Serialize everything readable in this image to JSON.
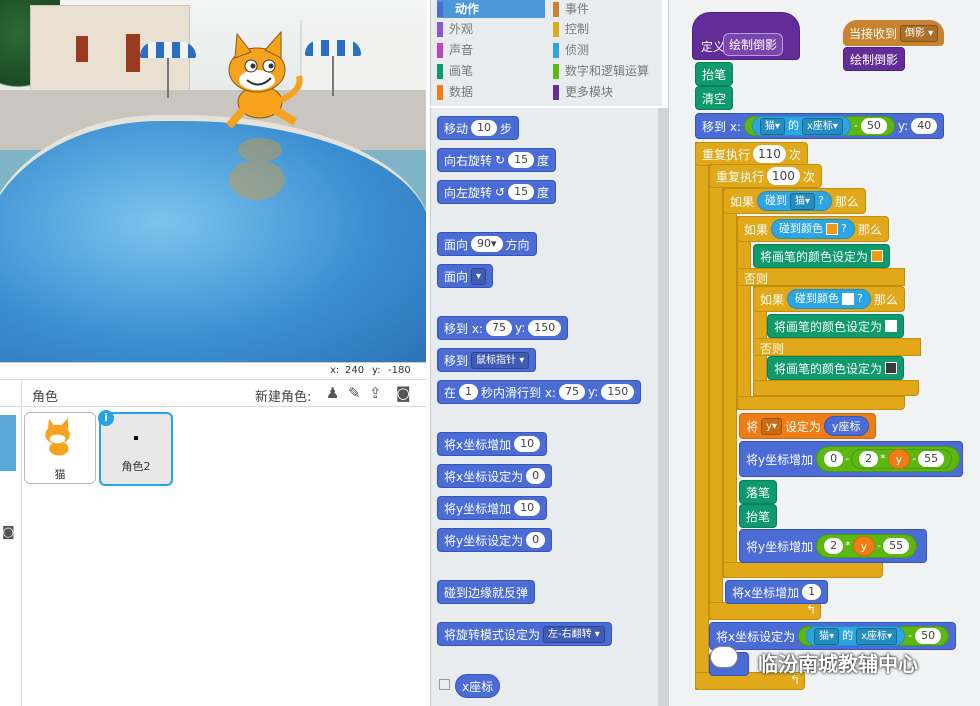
{
  "stage": {
    "coords": {
      "x_label": "x:",
      "x_value": "240",
      "y_label": "y:",
      "y_value": "-180"
    }
  },
  "sprites": {
    "header": "角色",
    "new_sprite_label": "新建角色:",
    "items": [
      {
        "name": "猫",
        "selected": false
      },
      {
        "name": "角色2",
        "selected": true
      }
    ],
    "info_badge": "i"
  },
  "categories": [
    {
      "label": "动作",
      "color": "#4a6cd4",
      "active": true
    },
    {
      "label": "事件",
      "color": "#c88330",
      "active": false
    },
    {
      "label": "外观",
      "color": "#8a55d7",
      "active": false
    },
    {
      "label": "控制",
      "color": "#e1a91a",
      "active": false
    },
    {
      "label": "声音",
      "color": "#bb42c3",
      "active": false
    },
    {
      "label": "侦测",
      "color": "#2ca5e2",
      "active": false
    },
    {
      "label": "画笔",
      "color": "#0e9a6c",
      "active": false
    },
    {
      "label": "数字和逻辑运算",
      "color": "#5cb712",
      "active": false
    },
    {
      "label": "数据",
      "color": "#ee7d16",
      "active": false
    },
    {
      "label": "更多模块",
      "color": "#632d99",
      "active": false
    }
  ],
  "palette": {
    "move": {
      "label": "移动",
      "steps": "10",
      "unit": "步"
    },
    "turn_right": {
      "label": "向右旋转",
      "deg": "15",
      "unit": "度"
    },
    "turn_left": {
      "label": "向左旋转",
      "deg": "15",
      "unit": "度"
    },
    "point_dir": {
      "label": "面向",
      "dir": "90▾",
      "unit": "方向"
    },
    "point_towards": {
      "label": "面向"
    },
    "goto_xy": {
      "label": "移到 x:",
      "x": "75",
      "ylabel": "y:",
      "y": "150"
    },
    "goto": {
      "label": "移到",
      "target": "鼠标指针"
    },
    "glide": {
      "label": "在",
      "secs": "1",
      "mid": "秒内滑行到 x:",
      "x": "75",
      "ylabel": "y:",
      "y": "150"
    },
    "change_x": {
      "label": "将x坐标增加",
      "val": "10"
    },
    "set_x": {
      "label": "将x坐标设定为",
      "val": "0"
    },
    "change_y": {
      "label": "将y坐标增加",
      "val": "10"
    },
    "set_y": {
      "label": "将y坐标设定为",
      "val": "0"
    },
    "bounce": {
      "label": "碰到边缘就反弹"
    },
    "rotation_style": {
      "label": "将旋转模式设定为",
      "val": "左-右翻转"
    },
    "xpos": {
      "label": "x座标"
    }
  },
  "script": {
    "define": {
      "label": "定义",
      "name": "绘制倒影"
    },
    "broadcast_hat": {
      "label": "当接收到",
      "msg": "倒影"
    },
    "call": {
      "label": "绘制倒影"
    },
    "pen_up": "抬笔",
    "clear": "清空",
    "move_to": {
      "label": "移到 x:",
      "obj": "猫",
      "of": "的",
      "prop": "x座标",
      "minus": "-",
      "num": "50",
      "ylabel": "y:",
      "y": "40"
    },
    "repeat1": {
      "label": "重复执行",
      "n": "110",
      "unit": "次"
    },
    "repeat2": {
      "label": "重复执行",
      "n": "100",
      "unit": "次"
    },
    "if1": {
      "label": "如果",
      "cond": "碰到",
      "obj": "猫",
      "q": "?",
      "then": "那么"
    },
    "if2": {
      "label": "如果",
      "cond": "碰到颜色",
      "q": "?",
      "then": "那么",
      "color": "#f29a12"
    },
    "setpen1": {
      "label": "将画笔的颜色设定为",
      "color": "#f29a12"
    },
    "else1": "否则",
    "if3": {
      "label": "如果",
      "cond": "碰到颜色",
      "q": "?",
      "then": "那么",
      "color": "#ffffff"
    },
    "setpen2": {
      "label": "将画笔的颜色设定为",
      "color": "#ffffff"
    },
    "else2": "否则",
    "setpen3": {
      "label": "将画笔的颜色设定为",
      "color": "#3a3a3a"
    },
    "set_var": {
      "label": "将",
      "var": "y",
      "mid": "设定为",
      "val": "y座标"
    },
    "change_y1": {
      "label": "将y坐标增加",
      "a": "0",
      "minus": "-",
      "b": "2",
      "times": "*",
      "v": "y",
      "minus2": "-",
      "c": "55"
    },
    "pen_down": "落笔",
    "pen_up2": "抬笔",
    "change_y2": {
      "label": "将y坐标增加",
      "b": "2",
      "times": "*",
      "v": "y",
      "minus": "-",
      "c": "55"
    },
    "change_x": {
      "label": "将x坐标增加",
      "val": "1"
    },
    "set_x": {
      "label": "将x坐标设定为",
      "obj": "猫",
      "of": "的",
      "prop": "x座标",
      "minus": "-",
      "num": "50"
    }
  },
  "watermark": "临汾南城教辅中心"
}
